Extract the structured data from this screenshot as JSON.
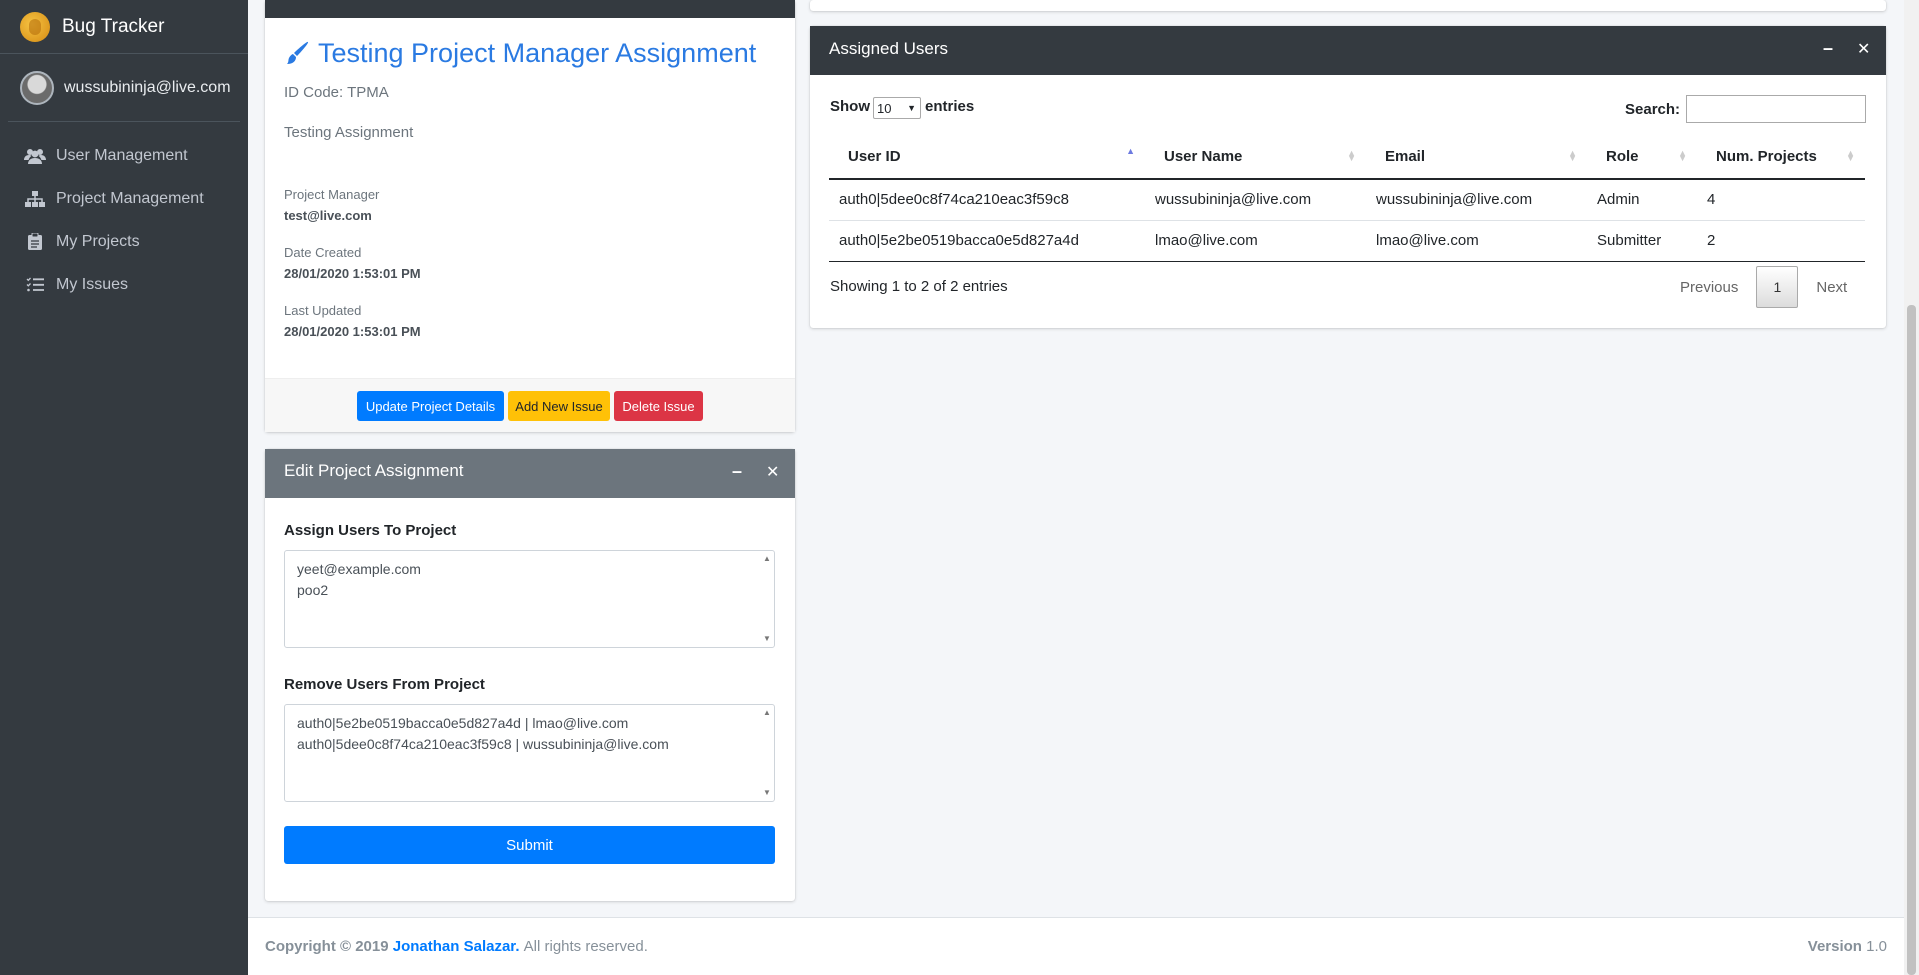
{
  "app": {
    "title": "Bug Tracker"
  },
  "user": {
    "email": "wussubininja@live.com"
  },
  "sidebar": {
    "items": [
      {
        "label": "User Management",
        "icon": "users-icon"
      },
      {
        "label": "Project Management",
        "icon": "sitemap-icon"
      },
      {
        "label": "My Projects",
        "icon": "clipboard-icon"
      },
      {
        "label": "My Issues",
        "icon": "list-icon"
      }
    ]
  },
  "project": {
    "title": "Testing Project Manager Assignment",
    "id_code": "ID Code: TPMA",
    "description": "Testing Assignment",
    "manager_label": "Project Manager",
    "manager_value": "test@live.com",
    "created_label": "Date Created",
    "created_value": "28/01/2020 1:53:01 PM",
    "updated_label": "Last Updated",
    "updated_value": "28/01/2020 1:53:01 PM",
    "buttons": {
      "update": "Update Project Details",
      "add_issue": "Add New Issue",
      "delete": "Delete Issue"
    }
  },
  "edit_assignment": {
    "title": "Edit Project Assignment",
    "assign_label": "Assign Users To Project",
    "assign_options": [
      "yeet@example.com",
      "poo2"
    ],
    "remove_label": "Remove Users From Project",
    "remove_options": [
      "auth0|5e2be0519bacca0e5d827a4d | lmao@live.com",
      "auth0|5dee0c8f74ca210eac3f59c8 | wussubininja@live.com"
    ],
    "submit": "Submit"
  },
  "assigned_users": {
    "title": "Assigned Users",
    "show_label": "Show",
    "entries_value": "10",
    "entries_label": "entries",
    "search_label": "Search:",
    "columns": [
      "User ID",
      "User Name",
      "Email",
      "Role",
      "Num. Projects"
    ],
    "rows": [
      [
        "auth0|5dee0c8f74ca210eac3f59c8",
        "wussubininja@live.com",
        "wussubininja@live.com",
        "Admin",
        "4"
      ],
      [
        "auth0|5e2be0519bacca0e5d827a4d",
        "lmao@live.com",
        "lmao@live.com",
        "Submitter",
        "2"
      ]
    ],
    "info": "Showing 1 to 2 of 2 entries",
    "pagination": {
      "previous": "Previous",
      "current": "1",
      "next": "Next"
    }
  },
  "footer": {
    "copyright": "Copyright © 2019",
    "author": "Jonathan Salazar.",
    "rights": "All rights reserved.",
    "version_label": "Version",
    "version_value": "1.0"
  },
  "colors": {
    "sidebar": "#343a40",
    "primary": "#007bff",
    "warning": "#ffc107",
    "danger": "#dc3545",
    "title_blue": "#2a7ae2"
  }
}
